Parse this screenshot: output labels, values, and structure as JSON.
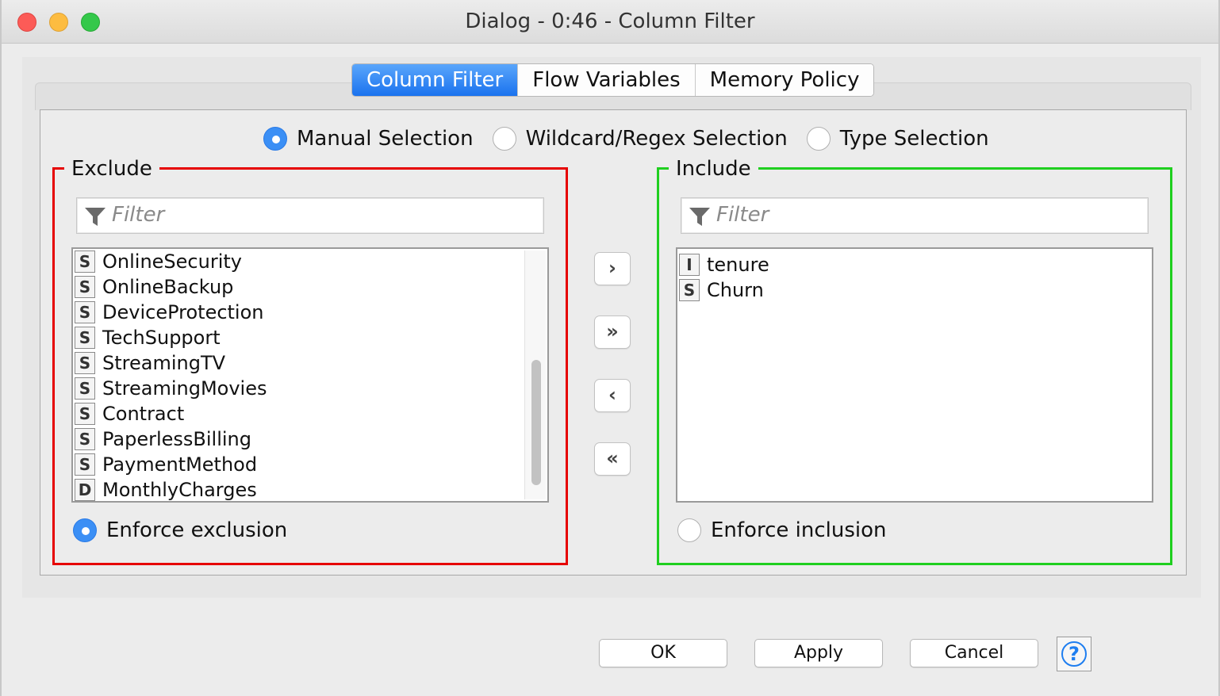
{
  "window": {
    "title": "Dialog - 0:46 - Column Filter"
  },
  "tabs": [
    {
      "label": "Column Filter",
      "active": true
    },
    {
      "label": "Flow Variables",
      "active": false
    },
    {
      "label": "Memory Policy",
      "active": false
    }
  ],
  "selection_mode": {
    "options": [
      {
        "label": "Manual Selection",
        "selected": true
      },
      {
        "label": "Wildcard/Regex Selection",
        "selected": false
      },
      {
        "label": "Type Selection",
        "selected": false
      }
    ]
  },
  "exclude": {
    "title": "Exclude",
    "filter_placeholder": "Filter",
    "items": [
      {
        "type": "S",
        "label": "OnlineSecurity"
      },
      {
        "type": "S",
        "label": "OnlineBackup"
      },
      {
        "type": "S",
        "label": "DeviceProtection"
      },
      {
        "type": "S",
        "label": "TechSupport"
      },
      {
        "type": "S",
        "label": "StreamingTV"
      },
      {
        "type": "S",
        "label": "StreamingMovies"
      },
      {
        "type": "S",
        "label": "Contract"
      },
      {
        "type": "S",
        "label": "PaperlessBilling"
      },
      {
        "type": "S",
        "label": "PaymentMethod"
      },
      {
        "type": "D",
        "label": "MonthlyCharges"
      }
    ],
    "enforce_label": "Enforce exclusion",
    "enforce_selected": true,
    "border_color": "#e60000"
  },
  "include": {
    "title": "Include",
    "filter_placeholder": "Filter",
    "items": [
      {
        "type": "I",
        "label": "tenure"
      },
      {
        "type": "S",
        "label": "Churn"
      }
    ],
    "enforce_label": "Enforce inclusion",
    "enforce_selected": false,
    "border_color": "#1fcf1f"
  },
  "move_buttons": {
    "add": "›",
    "add_all": "»",
    "remove": "‹",
    "remove_all": "«"
  },
  "footer": {
    "ok": "OK",
    "apply": "Apply",
    "cancel": "Cancel",
    "help": "?"
  },
  "colors": {
    "accent": "#3b8ff5",
    "active_tab": "#1a72ee"
  }
}
